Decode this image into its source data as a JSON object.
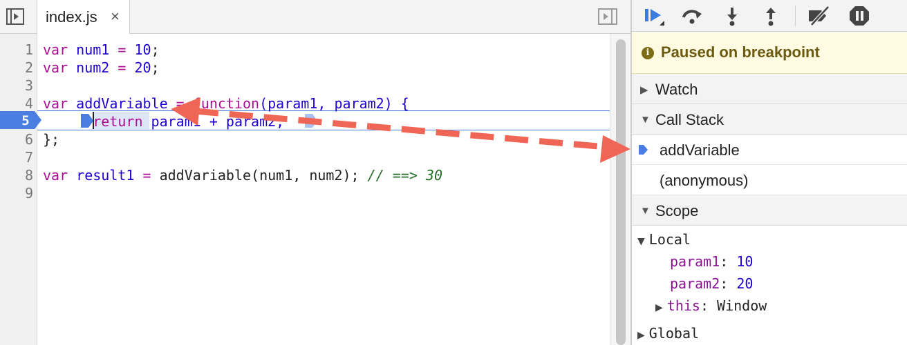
{
  "editor": {
    "tab_label": "index.js",
    "tab_close": "×",
    "line_numbers": [
      "1",
      "2",
      "3",
      "4",
      "5",
      "6",
      "7",
      "8",
      "9"
    ],
    "current_line": "5",
    "code": {
      "l1": {
        "kw": "var",
        "name": " num1",
        "op": " = ",
        "val": "10",
        "end": ";"
      },
      "l2": {
        "kw": "var",
        "name": " num2",
        "op": " = ",
        "val": "20",
        "end": ";"
      },
      "l4": {
        "kw": "var",
        "name": " addVariable",
        "op": " = ",
        "fn": "function",
        "rest": "(param1, param2) {"
      },
      "l5": {
        "indent": "      ",
        "kw": "return",
        "rest": " param1 + param2;"
      },
      "l6": "};",
      "l8": {
        "kw": "var",
        "name": " result1",
        "op": " = ",
        "rest": "addVariable(num1, num2); ",
        "comment": "// ==> 30"
      }
    }
  },
  "debugger": {
    "paused_icon": "i",
    "paused_text": "Paused on breakpoint",
    "sections": {
      "watch": "Watch",
      "call_stack": "Call Stack",
      "scope": "Scope"
    },
    "call_stack": [
      "addVariable",
      "(anonymous)"
    ],
    "scope": {
      "local_label": "Local",
      "vars": [
        {
          "name": "param1",
          "value": "10"
        },
        {
          "name": "param2",
          "value": "20"
        }
      ],
      "this_name": "this",
      "this_value": "Window",
      "global_label": "Global"
    }
  },
  "colors": {
    "accent": "#4a7ee0",
    "annotation_arrow": "#f06656",
    "paused_bg": "#fffbe3"
  },
  "icons": [
    "navigator-toggle-icon",
    "debugger-toggle-icon",
    "resume-icon",
    "step-over-icon",
    "step-into-icon",
    "step-out-icon",
    "deactivate-breakpoints-icon",
    "pause-on-exceptions-icon"
  ]
}
